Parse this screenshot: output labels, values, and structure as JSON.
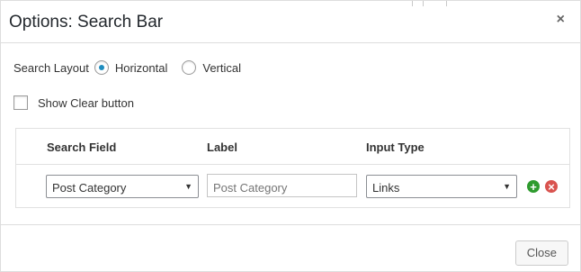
{
  "dialog": {
    "title": "Options: Search Bar",
    "close_icon": "×"
  },
  "search_layout": {
    "label": "Search Layout",
    "options": [
      {
        "label": "Horizontal",
        "checked": true
      },
      {
        "label": "Vertical",
        "checked": false
      }
    ]
  },
  "show_clear": {
    "label": "Show Clear button",
    "checked": false
  },
  "table": {
    "headers": [
      "Search Field",
      "Label",
      "Input Type"
    ],
    "rows": [
      {
        "search_field": "Post Category",
        "label_placeholder": "Post Category",
        "input_type": "Links"
      }
    ]
  },
  "footer": {
    "close_label": "Close"
  },
  "colors": {
    "radio_accent": "#1e8cbe",
    "add_green": "#2e9b2e",
    "remove_red": "#d9534f"
  }
}
